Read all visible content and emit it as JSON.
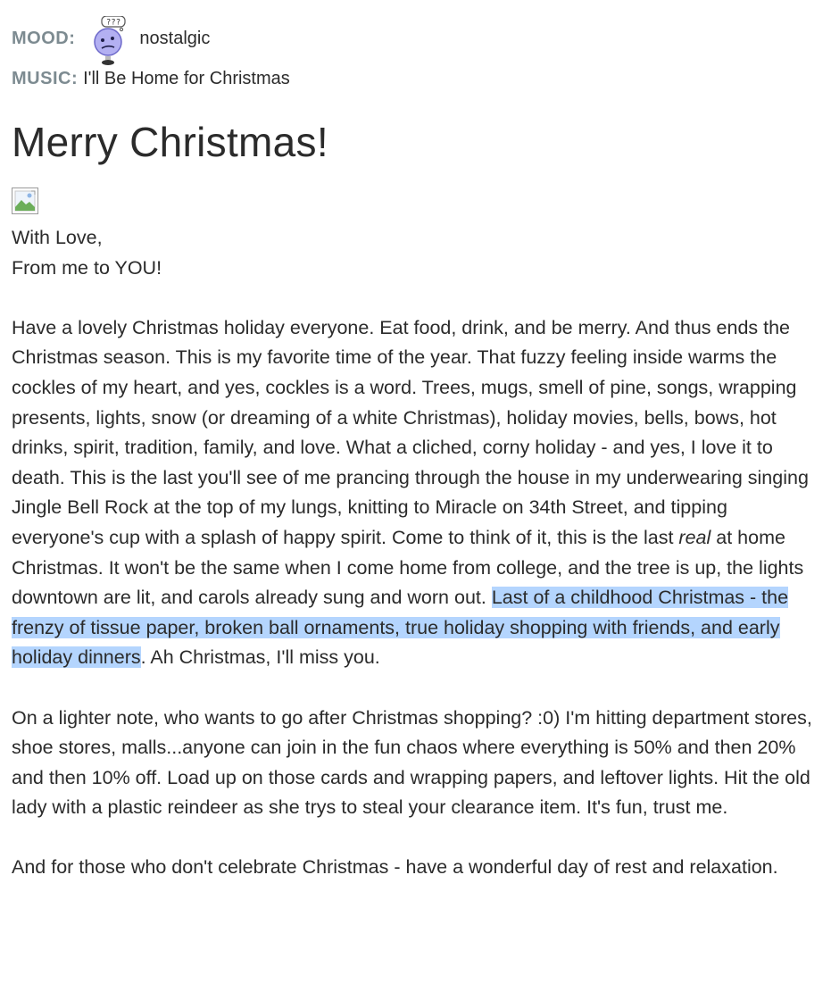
{
  "meta": {
    "mood_label": "MOOD:",
    "mood_icon": "confused-face-icon",
    "mood_value": "nostalgic",
    "music_label": "MUSIC:",
    "music_value": "I'll Be Home for Christmas"
  },
  "post": {
    "title": "Merry Christmas!",
    "image_icon": "broken-image-icon",
    "greeting_line1": "With Love,",
    "greeting_line2": "From me to YOU!",
    "p1_part1": "Have a lovely Christmas holiday everyone. Eat food, drink, and be merry. And thus ends the Christmas season. This is my favorite time of the year. That fuzzy feeling inside warms the cockles of my heart, and yes, cockles is a word. Trees, mugs, smell of pine, songs, wrapping presents, lights, snow (or dreaming of a white Christmas), holiday movies, bells, bows, hot drinks, spirit, tradition, family, and love. What a cliched, corny holiday - and yes, I love it to death. This is the last you'll see of me prancing through the house in my underwearing singing Jingle Bell Rock at the top of my lungs, knitting to Miracle on 34th Street, and tipping everyone's cup with a splash of happy spirit. Come to think of it, this is the last ",
    "p1_italic": "real",
    "p1_part2": " at home Christmas. It won't be the same when I come home from college, and the tree is up, the lights downtown are lit, and carols already sung and worn out. ",
    "p1_highlight": "Last of a childhood Christmas - the frenzy of tissue paper, broken ball ornaments, true holiday shopping with friends, and early holiday dinners",
    "p1_part3": ". Ah Christmas, I'll miss you.",
    "p2": "On a lighter note, who wants to go after Christmas shopping? :0) I'm hitting department stores, shoe stores, malls...anyone can join in the fun chaos where everything is 50% and then 20% and then 10% off. Load up on those cards and wrapping papers, and leftover lights. Hit the old lady with a plastic reindeer as she trys to steal your clearance item. It's fun, trust me.",
    "p3": "And for those who don't celebrate Christmas - have a wonderful day of rest and relaxation."
  },
  "colors": {
    "label": "#7d8b91",
    "text": "#2b2b2b",
    "selection": "#b4d5fe"
  }
}
